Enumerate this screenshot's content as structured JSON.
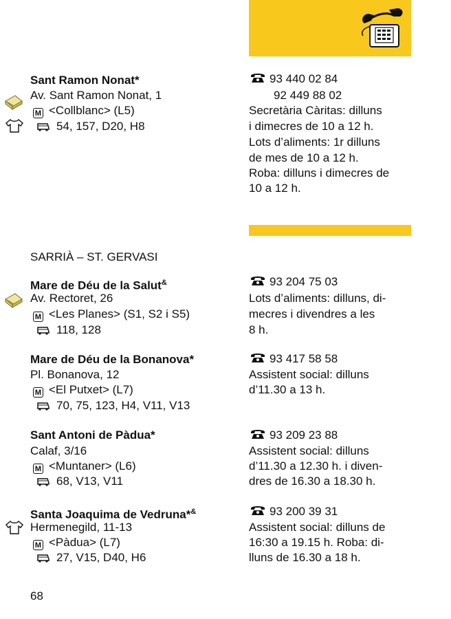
{
  "top": {
    "phone_illustration": "telephone-illustration"
  },
  "entries": [
    {
      "name": "Sant Ramon Nonat*",
      "address": "Av. Sant Ramon Nonat, 1",
      "metro": "<Collblanc> (L5)",
      "bus": "54, 157, D20, H8",
      "phone": "93 440 02 84",
      "phone2": "92 449 88 02",
      "info": [
        "Secretària Càritas: dilluns",
        "i dimecres de 10 a 12 h.",
        "Lots d’aliments: 1r dilluns",
        "de mes de 10 a 12 h.",
        "Roba: dilluns i dimecres de",
        "10 a 12 h."
      ]
    },
    {
      "name": "Mare de Déu de la Salut",
      "name_sup": "&",
      "address": "Av. Rectoret, 26",
      "metro": "<Les Planes> (S1, S2 i S5)",
      "bus": "118, 128",
      "phone": "93 204 75 03",
      "info": [
        "Lots d’aliments: dilluns, di-",
        "mecres i divendres a les",
        "8 h."
      ]
    },
    {
      "name": "Mare de Déu de la Bonanova*",
      "address": "Pl. Bonanova, 12",
      "metro": "<El Putxet> (L7)",
      "bus": "70, 75, 123, H4, V11, V13",
      "phone": "93 417 58 58",
      "info": [
        "Assistent social: dilluns",
        "d’11.30 a 13 h."
      ]
    },
    {
      "name": "Sant Antoni de Pàdua*",
      "address": "Calaf, 3/16",
      "metro": "<Muntaner> (L6)",
      "bus": "68, V13, V11",
      "phone": "93 209 23 88",
      "info": [
        "Assistent social: dilluns",
        "d’11.30 a 12.30 h. i diven-",
        "dres de 16.30 a 18.30 h."
      ]
    },
    {
      "name": "Santa Joaquima de Vedruna*",
      "name_sup": "&",
      "address": "Hermenegild, 11-13",
      "metro": "<Pàdua> (L7)",
      "bus": "27, V15, D40, H6",
      "phone": "93 200 39 31",
      "info": [
        "Assistent social: dilluns de",
        "16:30 a 19.15 h. Roba: di-",
        "lluns de 16.30 a 18 h."
      ]
    }
  ],
  "section_title": "SARRIÀ – ST. GERVASI",
  "metro_symbol": "M",
  "page_number": "68",
  "colors": {
    "accent": "#f9c81d",
    "text": "#111111"
  }
}
